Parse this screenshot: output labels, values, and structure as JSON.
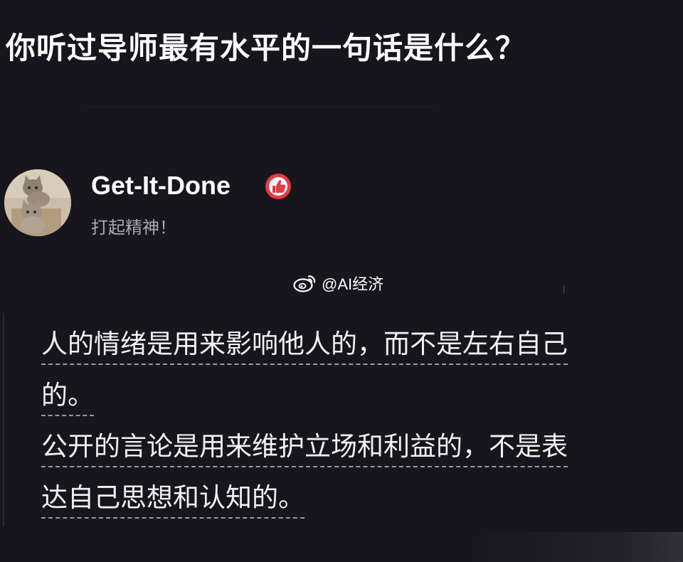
{
  "post": {
    "question": "你听过导师最有水平的一句话是什么？"
  },
  "user": {
    "name": "Get-It-Done",
    "bio": "打起精神！",
    "avatar_icon": "two-cats-photo",
    "badge_icon": "thumbs-up-badge-icon",
    "badge_color": "#e53945"
  },
  "watermark": {
    "text": "@AI经济",
    "icon": "weibo-logo-icon"
  },
  "answer": {
    "lines": [
      "人的情绪是用来影响他人的，而不是左右自己",
      "的。",
      "公开的言论是用来维护立场和利益的，不是表",
      "达自己思想和认知的。"
    ]
  },
  "colors": {
    "background": "#17161c",
    "text": "#f2f2f4",
    "muted": "#a9a8b0"
  }
}
